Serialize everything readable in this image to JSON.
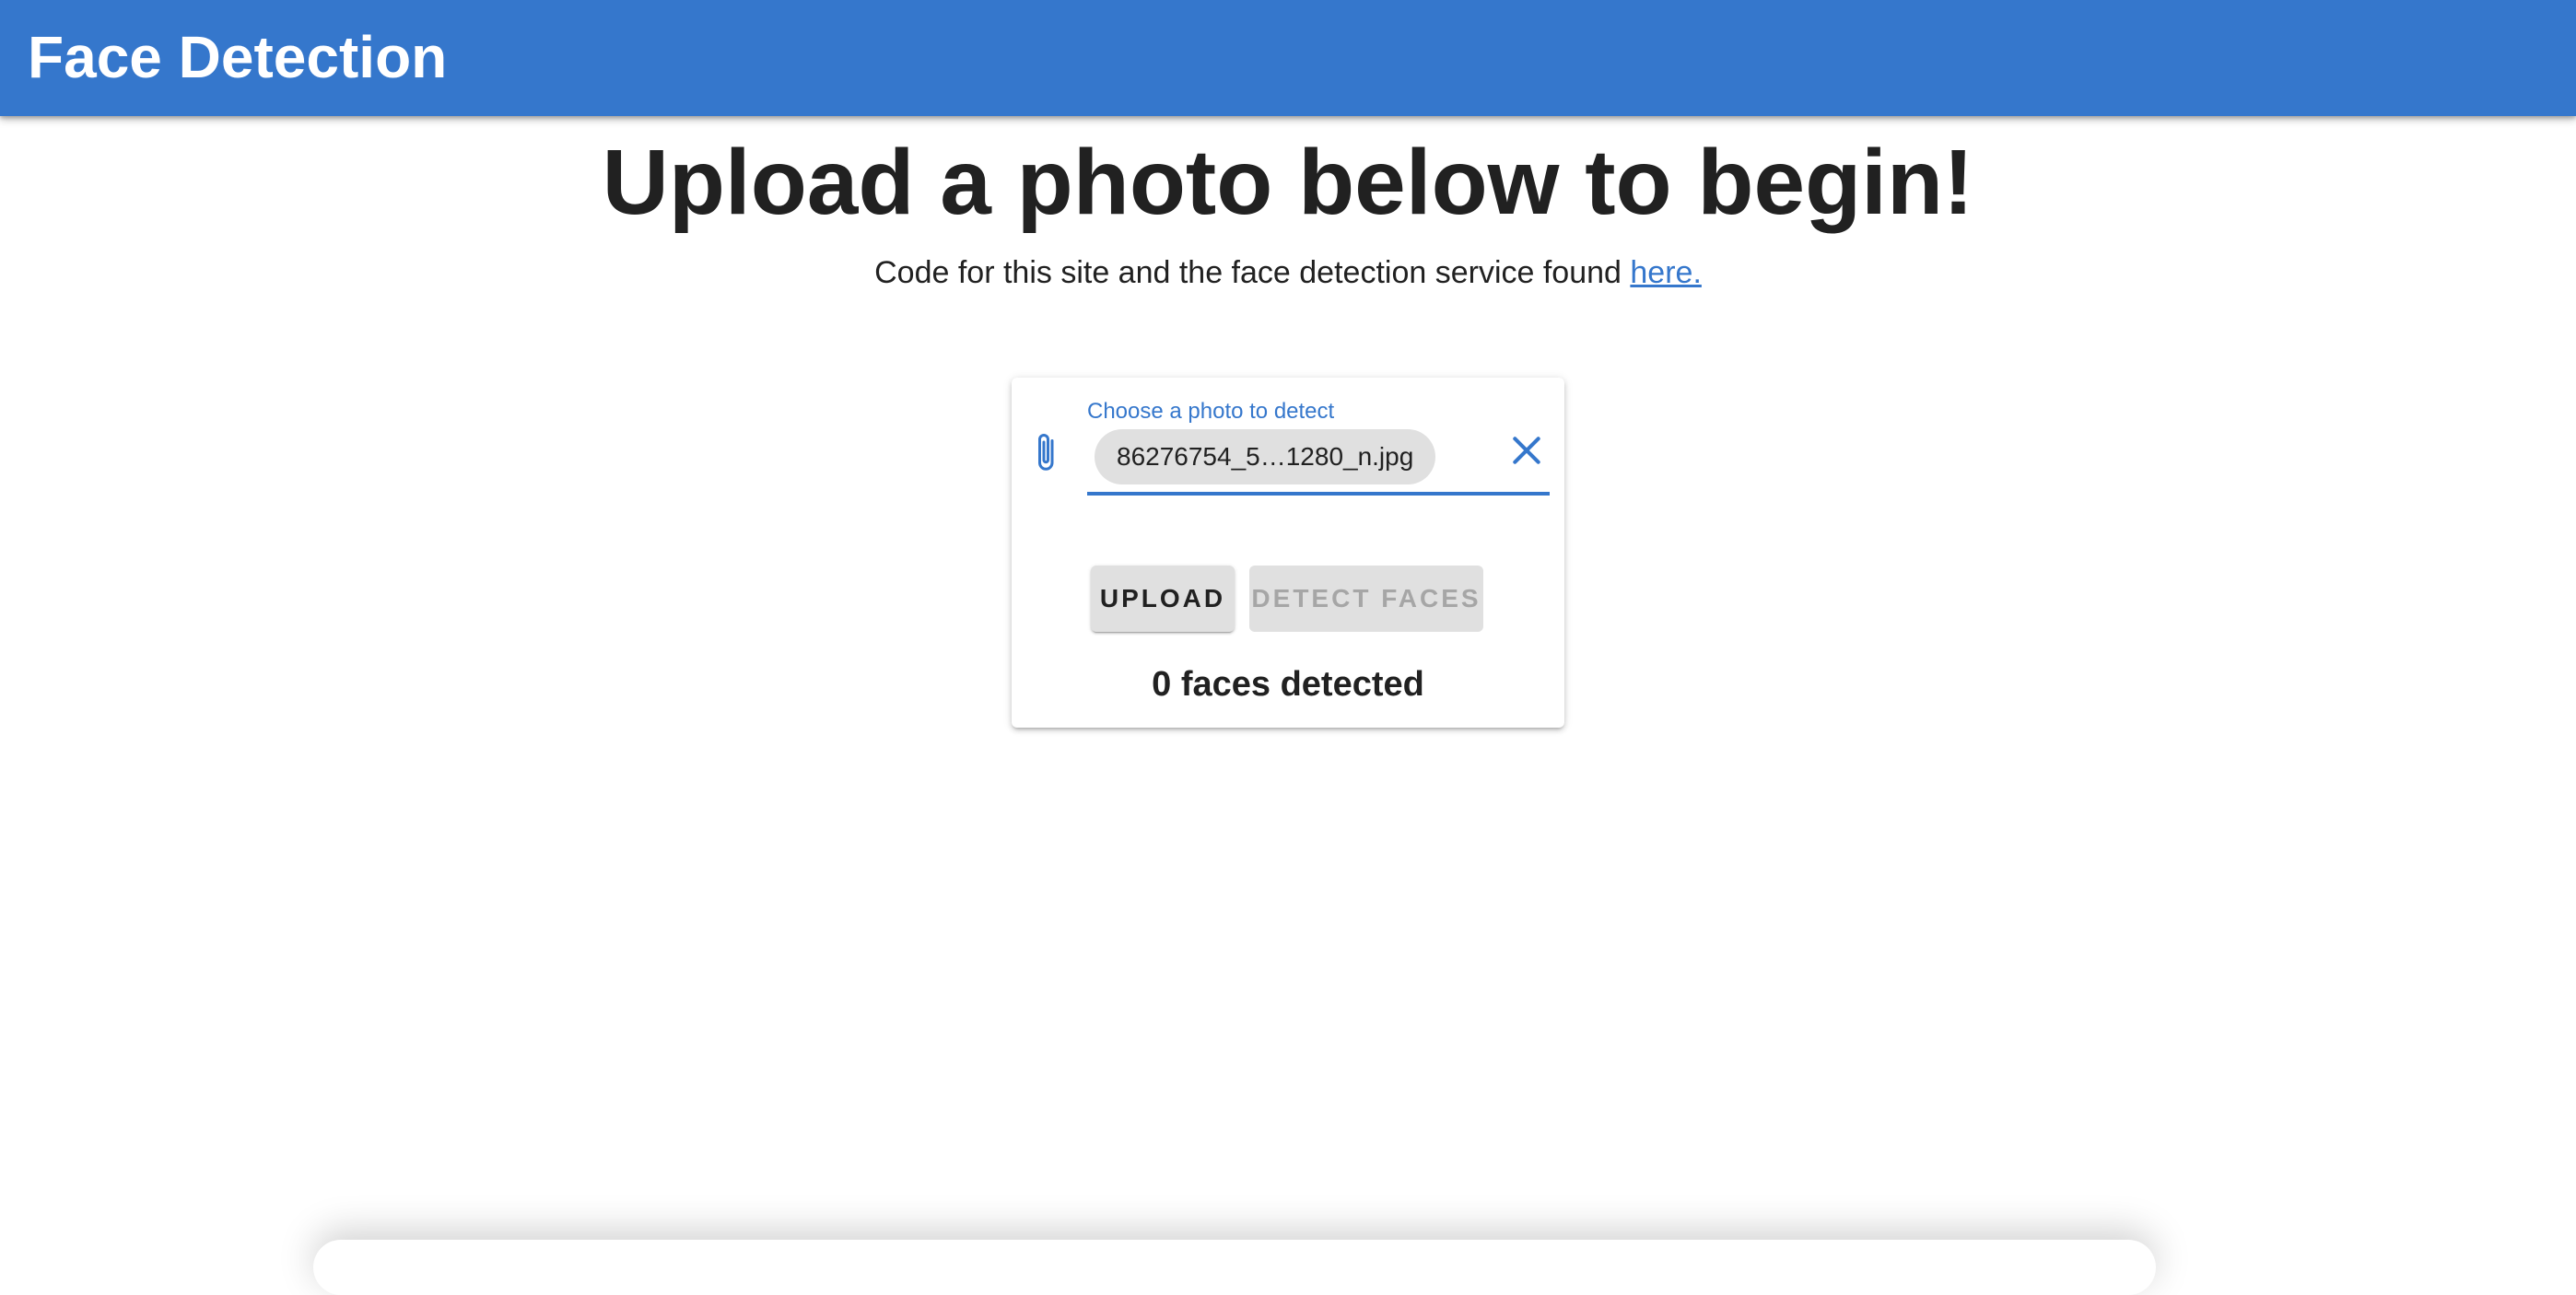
{
  "app_bar": {
    "title": "Face Detection",
    "color": "#3577cc"
  },
  "main": {
    "headline": "Upload a photo below to begin!",
    "subline_text": "Code for this site and the face detection service found ",
    "subline_link": "here."
  },
  "upload_card": {
    "file_input": {
      "label": "Choose a photo to detect",
      "selected_file": "86276754_5…1280_n.jpg",
      "attach_icon": "paperclip-icon",
      "clear_icon": "close-icon"
    },
    "upload_button": "Upload",
    "detect_button": "Detect Faces",
    "detect_button_state": "disabled",
    "faces_result": "0 faces detected"
  }
}
